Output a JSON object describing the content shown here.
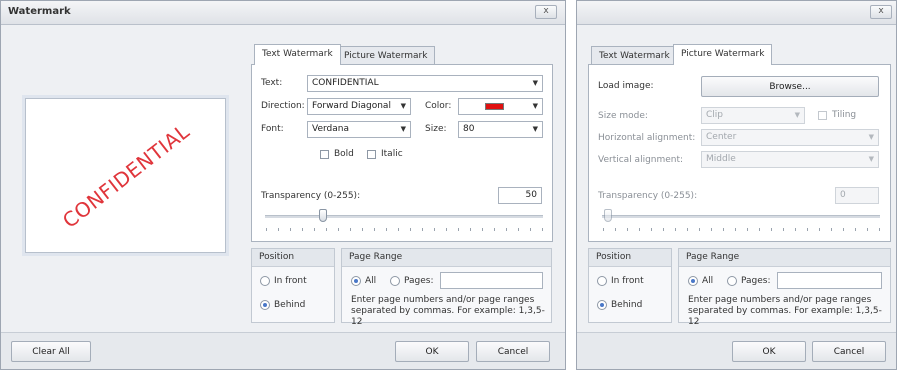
{
  "left_dialog": {
    "title": "Watermark",
    "close_label": "x",
    "preview_text": "CONFIDENTIAL",
    "tabs": [
      {
        "label": "Text Watermark"
      },
      {
        "label": "Picture Watermark"
      }
    ],
    "text_label": "Text:",
    "text_value": "CONFIDENTIAL",
    "direction_label": "Direction:",
    "direction_value": "Forward Diagonal",
    "color_label": "Color:",
    "color_value": "#e01010",
    "font_label": "Font:",
    "font_value": "Verdana",
    "size_label": "Size:",
    "size_value": "80",
    "bold_label": "Bold",
    "italic_label": "Italic",
    "transparency_label": "Transparency (0-255):",
    "transparency_value": "50",
    "position": {
      "header": "Position",
      "in_front": "In front",
      "behind": "Behind"
    },
    "page_range": {
      "header": "Page Range",
      "all": "All",
      "pages": "Pages:",
      "hint": "Enter page numbers and/or page ranges separated by commas. For example: 1,3,5-12"
    },
    "clear_all": "Clear All",
    "ok": "OK",
    "cancel": "Cancel"
  },
  "right_dialog": {
    "close_label": "x",
    "tabs": [
      {
        "label": "Text Watermark"
      },
      {
        "label": "Picture Watermark"
      }
    ],
    "load_image_label": "Load image:",
    "browse_label": "Browse...",
    "size_mode_label": "Size mode:",
    "size_mode_value": "Clip",
    "tiling_label": "Tiling",
    "h_align_label": "Horizontal alignment:",
    "h_align_value": "Center",
    "v_align_label": "Vertical alignment:",
    "v_align_value": "Middle",
    "transparency_label": "Transparency (0-255):",
    "transparency_value": "0",
    "position": {
      "header": "Position",
      "in_front": "In front",
      "behind": "Behind"
    },
    "page_range": {
      "header": "Page Range",
      "all": "All",
      "pages": "Pages:",
      "hint": "Enter page numbers and/or page ranges separated by commas. For example: 1,3,5-12"
    },
    "ok": "OK",
    "cancel": "Cancel"
  },
  "icons": {
    "dropdown": "chevron-down-icon",
    "close": "close-icon"
  }
}
